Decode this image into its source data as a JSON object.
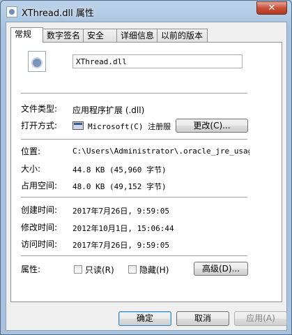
{
  "window": {
    "title": "XThread.dll 属性",
    "close_glyph": "✕"
  },
  "tabs": [
    {
      "label": "常规"
    },
    {
      "label": "数字签名"
    },
    {
      "label": "安全"
    },
    {
      "label": "详细信息"
    },
    {
      "label": "以前的版本"
    }
  ],
  "file": {
    "name": "XThread.dll"
  },
  "props": {
    "type_label": "文件类型:",
    "type_value": "应用程序扩展 (.dll)",
    "openwith_label": "打开方式:",
    "openwith_value": "Microsoft(C) 注册服",
    "change_button": "更改(C)...",
    "location_label": "位置:",
    "location_value": "C:\\Users\\Administrator\\.oracle_jre_usage\\",
    "size_label": "大小:",
    "size_value": "44.8 KB (45,960 字节)",
    "disksize_label": "占用空间:",
    "disksize_value": "48.0 KB (49,152 字节)",
    "created_label": "创建时间:",
    "created_value": "2017年7月26日, 9:59:05",
    "modified_label": "修改时间:",
    "modified_value": "2012年10月1日, 15:06:44",
    "accessed_label": "访问时间:",
    "accessed_value": "2017年7月26日, 9:59:05",
    "attributes_label": "属性:",
    "readonly_label": "只读(R)",
    "hidden_label": "隐藏(H)",
    "advanced_button": "高级(D)..."
  },
  "footer": {
    "ok": "确定",
    "cancel": "取消",
    "apply": "应用(A)"
  }
}
